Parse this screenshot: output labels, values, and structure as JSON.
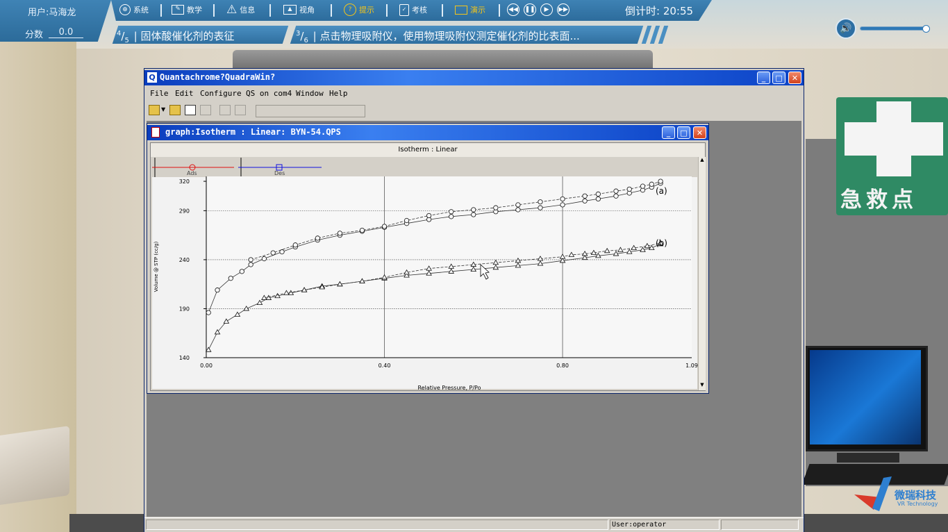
{
  "hud": {
    "user": "用户:马海龙",
    "score_label": "分数",
    "score_value": "0.0",
    "menu": [
      {
        "label": "系统",
        "icon": "globe-icon"
      },
      {
        "label": "教学",
        "icon": "teach-icon"
      },
      {
        "label": "信息",
        "icon": "warning-icon"
      },
      {
        "label": "视角",
        "icon": "image-icon"
      },
      {
        "label": "提示",
        "icon": "question-icon"
      },
      {
        "label": "考核",
        "icon": "clipboard-icon"
      },
      {
        "label": "演示",
        "icon": "monitor-icon"
      }
    ],
    "media_controls": [
      "rewind-icon",
      "pause-icon",
      "play-icon",
      "fast-forward-icon"
    ],
    "timer": "倒计时: 20:55",
    "steps": [
      {
        "num": "4",
        "den": "5",
        "text": "固体酸催化剂的表征"
      },
      {
        "num": "3",
        "den": "6",
        "text": "点击物理吸附仪，使用物理吸附仪测定催化剂的比表面..."
      }
    ],
    "highlight_color": "#f5c518"
  },
  "scene": {
    "first_aid_text": "急救点",
    "logo_text": "微瑞科技",
    "logo_sub": "VR Technology"
  },
  "app": {
    "title": "Quantachrome?QuadraWin?",
    "menu": [
      "File",
      "Edit",
      "Configure",
      "QS on com4",
      "Window",
      "Help"
    ],
    "status_user": "User:operator"
  },
  "graph": {
    "title": "graph:Isotherm :   Linear: BYN-54.QPS",
    "header": "Isotherm :  Linear",
    "legend": [
      "Ads",
      "Des"
    ]
  },
  "chart_data": {
    "type": "line",
    "title": "Isotherm :  Linear",
    "xlabel": "Relative Pressure, P/Po",
    "ylabel": "Volume @ STP (cc/g)",
    "xlim": [
      0.0,
      1.09
    ],
    "ylim": [
      140,
      325
    ],
    "x_ticks": [
      "0.00",
      "0.40",
      "0.80",
      "1.09"
    ],
    "y_ticks": [
      "140",
      "190",
      "240",
      "290",
      "320"
    ],
    "grid": true,
    "legend": "top-left",
    "annotations": [
      "(a)",
      "(b)"
    ],
    "series": [
      {
        "name": "Ads",
        "marker": "circle",
        "curve": "a",
        "x": [
          0.005,
          0.025,
          0.055,
          0.08,
          0.1,
          0.13,
          0.17,
          0.2,
          0.25,
          0.3,
          0.35,
          0.4,
          0.45,
          0.5,
          0.55,
          0.6,
          0.65,
          0.7,
          0.75,
          0.8,
          0.85,
          0.88,
          0.92,
          0.95,
          0.98,
          1.0,
          1.02
        ],
        "y": [
          186,
          209,
          221,
          228,
          235,
          241,
          248,
          253,
          260,
          265,
          269,
          273,
          277,
          281,
          284,
          286,
          289,
          291,
          293,
          296,
          300,
          302,
          305,
          308,
          311,
          314,
          318
        ]
      },
      {
        "name": "Des",
        "marker": "circle",
        "curve": "a",
        "x": [
          0.1,
          0.15,
          0.2,
          0.25,
          0.3,
          0.35,
          0.4,
          0.45,
          0.5,
          0.55,
          0.6,
          0.65,
          0.7,
          0.75,
          0.8,
          0.85,
          0.88,
          0.92,
          0.95,
          0.98,
          1.0,
          1.02
        ],
        "y": [
          240,
          247,
          255,
          262,
          267,
          270,
          274,
          280,
          285,
          289,
          291,
          293,
          296,
          299,
          302,
          305,
          307,
          310,
          312,
          315,
          317,
          320
        ]
      },
      {
        "name": "Ads",
        "marker": "triangle",
        "curve": "b",
        "x": [
          0.005,
          0.025,
          0.045,
          0.07,
          0.09,
          0.12,
          0.14,
          0.16,
          0.19,
          0.22,
          0.26,
          0.3,
          0.35,
          0.4,
          0.45,
          0.5,
          0.55,
          0.6,
          0.65,
          0.7,
          0.75,
          0.8,
          0.85,
          0.88,
          0.92,
          0.95,
          0.98,
          1.0,
          1.02
        ],
        "y": [
          148,
          166,
          177,
          184,
          190,
          196,
          201,
          203,
          206,
          209,
          213,
          215,
          218,
          221,
          224,
          226,
          228,
          230,
          232,
          234,
          236,
          239,
          242,
          244,
          246,
          248,
          250,
          252,
          256
        ]
      },
      {
        "name": "Des",
        "marker": "triangle",
        "curve": "b",
        "x": [
          0.13,
          0.18,
          0.22,
          0.26,
          0.3,
          0.35,
          0.4,
          0.45,
          0.5,
          0.55,
          0.6,
          0.65,
          0.7,
          0.75,
          0.8,
          0.82,
          0.85,
          0.87,
          0.9,
          0.93,
          0.96,
          0.99,
          1.02
        ],
        "y": [
          201,
          206,
          209,
          212,
          215,
          218,
          222,
          227,
          231,
          233,
          235,
          237,
          239,
          241,
          243,
          245,
          246,
          247,
          249,
          250,
          252,
          254,
          257
        ]
      }
    ]
  }
}
